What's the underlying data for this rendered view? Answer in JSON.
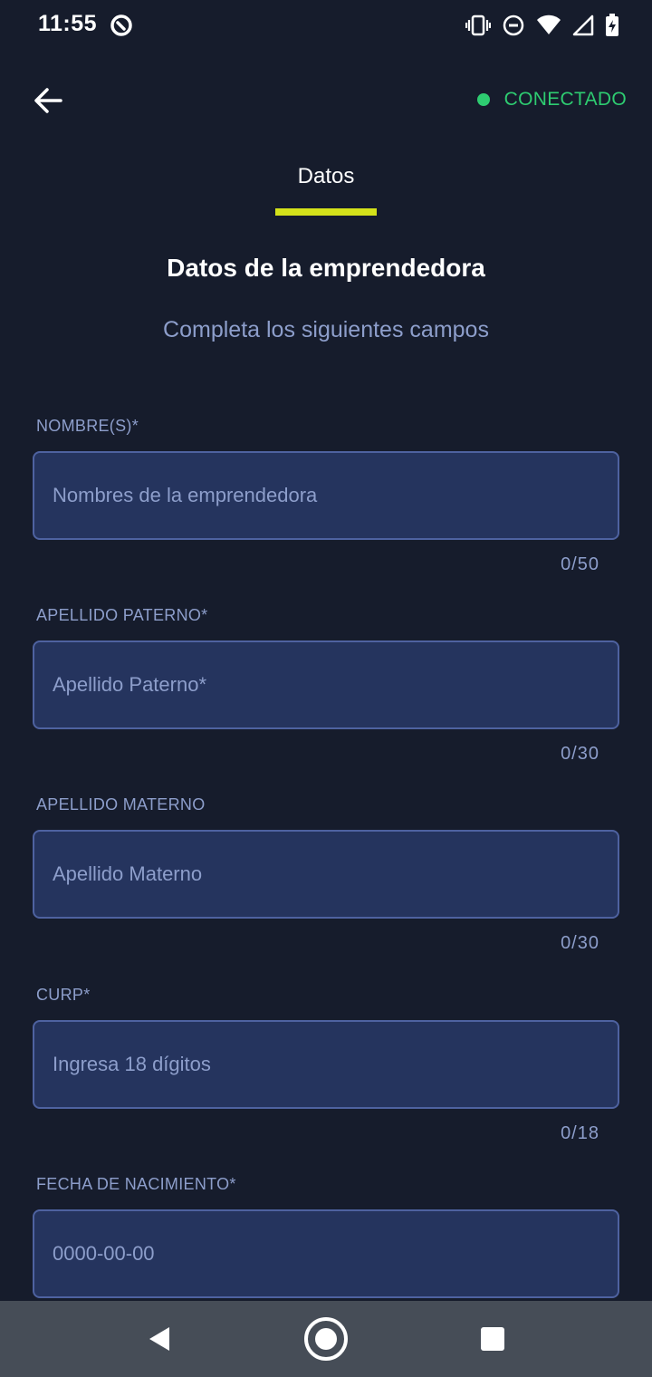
{
  "status_bar": {
    "time": "11:55"
  },
  "header": {
    "connection_status": "CONECTADO",
    "status_color": "#2ecc71"
  },
  "tabs": [
    {
      "label": "Datos",
      "active": true
    }
  ],
  "form": {
    "title": "Datos de la emprendedora",
    "subtitle": "Completa los siguientes campos",
    "fields": [
      {
        "label": "NOMBRE(S)*",
        "value": "",
        "placeholder": "Nombres de la emprendedora",
        "counter": "0/50"
      },
      {
        "label": "APELLIDO PATERNO*",
        "value": "",
        "placeholder": "Apellido Paterno*",
        "counter": "0/30"
      },
      {
        "label": "APELLIDO MATERNO",
        "value": "",
        "placeholder": "Apellido Materno",
        "counter": "0/30"
      },
      {
        "label": "CURP*",
        "value": "",
        "placeholder": "Ingresa 18 dígitos",
        "counter": "0/18"
      },
      {
        "label": "FECHA DE NACIMIENTO*",
        "value": "",
        "placeholder": "0000-00-00"
      }
    ]
  },
  "colors": {
    "background": "#161c2c",
    "accent": "#d4e21a",
    "input_background": "#25345e",
    "input_border": "#4e62a0",
    "muted_text": "#8d9ecb"
  },
  "icons": {
    "status": [
      "app-notification-icon",
      "vibrate-icon",
      "do-not-disturb-icon",
      "wifi-icon",
      "signal-icon",
      "battery-charging-icon"
    ],
    "header": [
      "back-arrow-icon"
    ],
    "navigation": [
      "nav-back-icon",
      "nav-home-icon",
      "nav-recents-icon"
    ]
  }
}
